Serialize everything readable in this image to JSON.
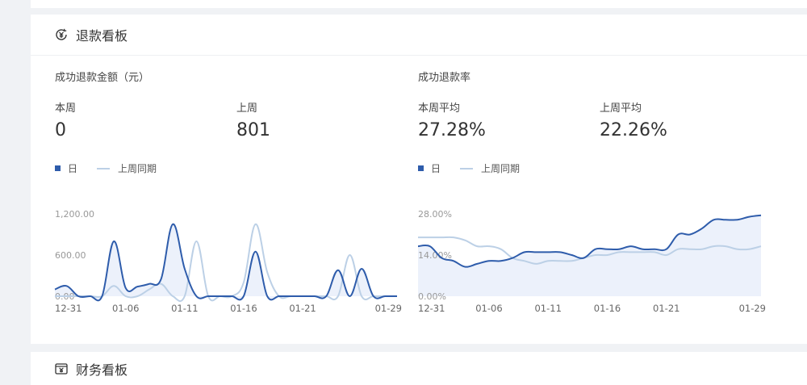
{
  "refund_board": {
    "title": "退款看板",
    "amount_panel": {
      "title": "成功退款金额（元）",
      "this_week_label": "本周",
      "this_week_value": "0",
      "last_week_label": "上周",
      "last_week_value": "801",
      "legend_day": "日",
      "legend_last_period": "上周同期"
    },
    "rate_panel": {
      "title": "成功退款率",
      "this_week_label": "本周平均",
      "this_week_value": "27.28%",
      "last_week_label": "上周平均",
      "last_week_value": "22.26%",
      "legend_day": "日",
      "legend_last_period": "上周同期"
    }
  },
  "finance_board": {
    "title": "财务看板"
  },
  "colors": {
    "series_day": "#2e5cab",
    "series_last": "#bcd0e6",
    "area_fill": "#e9effa",
    "page_bg": "#f0f2f5"
  },
  "chart_data": [
    {
      "type": "line",
      "title": "成功退款金额（元）",
      "x_ticks": [
        "12-31",
        "01-06",
        "01-11",
        "01-16",
        "01-21",
        "01-29"
      ],
      "y_ticks": [
        "1,200.00",
        "600.00",
        "0.00"
      ],
      "ylim": [
        0,
        1200
      ],
      "x": [
        "12-31",
        "01-01",
        "01-02",
        "01-03",
        "01-04",
        "01-05",
        "01-06",
        "01-07",
        "01-08",
        "01-09",
        "01-10",
        "01-11",
        "01-12",
        "01-13",
        "01-14",
        "01-15",
        "01-16",
        "01-17",
        "01-18",
        "01-19",
        "01-20",
        "01-21",
        "01-22",
        "01-23",
        "01-24",
        "01-25",
        "01-26",
        "01-27",
        "01-28",
        "01-29"
      ],
      "series": [
        {
          "name": "日",
          "values": [
            100,
            150,
            0,
            0,
            0,
            800,
            120,
            140,
            180,
            250,
            1050,
            400,
            0,
            0,
            0,
            0,
            0,
            650,
            0,
            0,
            0,
            0,
            0,
            0,
            380,
            0,
            400,
            0,
            0,
            0
          ]
        },
        {
          "name": "上周同期",
          "values": [
            0,
            0,
            0,
            0,
            0,
            150,
            0,
            0,
            100,
            180,
            0,
            0,
            800,
            0,
            0,
            0,
            200,
            1050,
            350,
            0,
            0,
            0,
            0,
            0,
            0,
            600,
            0,
            0,
            0,
            0
          ]
        }
      ]
    },
    {
      "type": "area",
      "title": "成功退款率",
      "x_ticks": [
        "12-31",
        "01-06",
        "01-11",
        "01-16",
        "01-21",
        "01-29"
      ],
      "y_ticks": [
        "28.00%",
        "14.00%",
        "0.00%"
      ],
      "ylim": [
        0,
        28
      ],
      "x": [
        "12-31",
        "01-01",
        "01-02",
        "01-03",
        "01-04",
        "01-05",
        "01-06",
        "01-07",
        "01-08",
        "01-09",
        "01-10",
        "01-11",
        "01-12",
        "01-13",
        "01-14",
        "01-15",
        "01-16",
        "01-17",
        "01-18",
        "01-19",
        "01-20",
        "01-21",
        "01-22",
        "01-23",
        "01-24",
        "01-25",
        "01-26",
        "01-27",
        "01-28",
        "01-29"
      ],
      "series": [
        {
          "name": "日",
          "values": [
            17,
            17,
            13,
            12,
            10,
            11,
            12,
            12,
            13,
            15,
            15,
            15,
            15,
            14,
            13,
            16,
            16,
            16,
            17,
            16,
            16,
            16,
            21,
            21,
            23,
            26,
            26,
            26,
            27,
            27.5
          ]
        },
        {
          "name": "上周同期",
          "values": [
            20,
            20,
            20,
            20,
            19,
            17,
            17,
            16,
            13,
            12,
            11,
            12,
            12,
            12,
            13,
            14,
            14,
            15,
            15,
            15,
            15,
            14,
            16,
            16,
            16,
            17,
            17,
            16,
            16,
            17
          ]
        }
      ]
    }
  ]
}
